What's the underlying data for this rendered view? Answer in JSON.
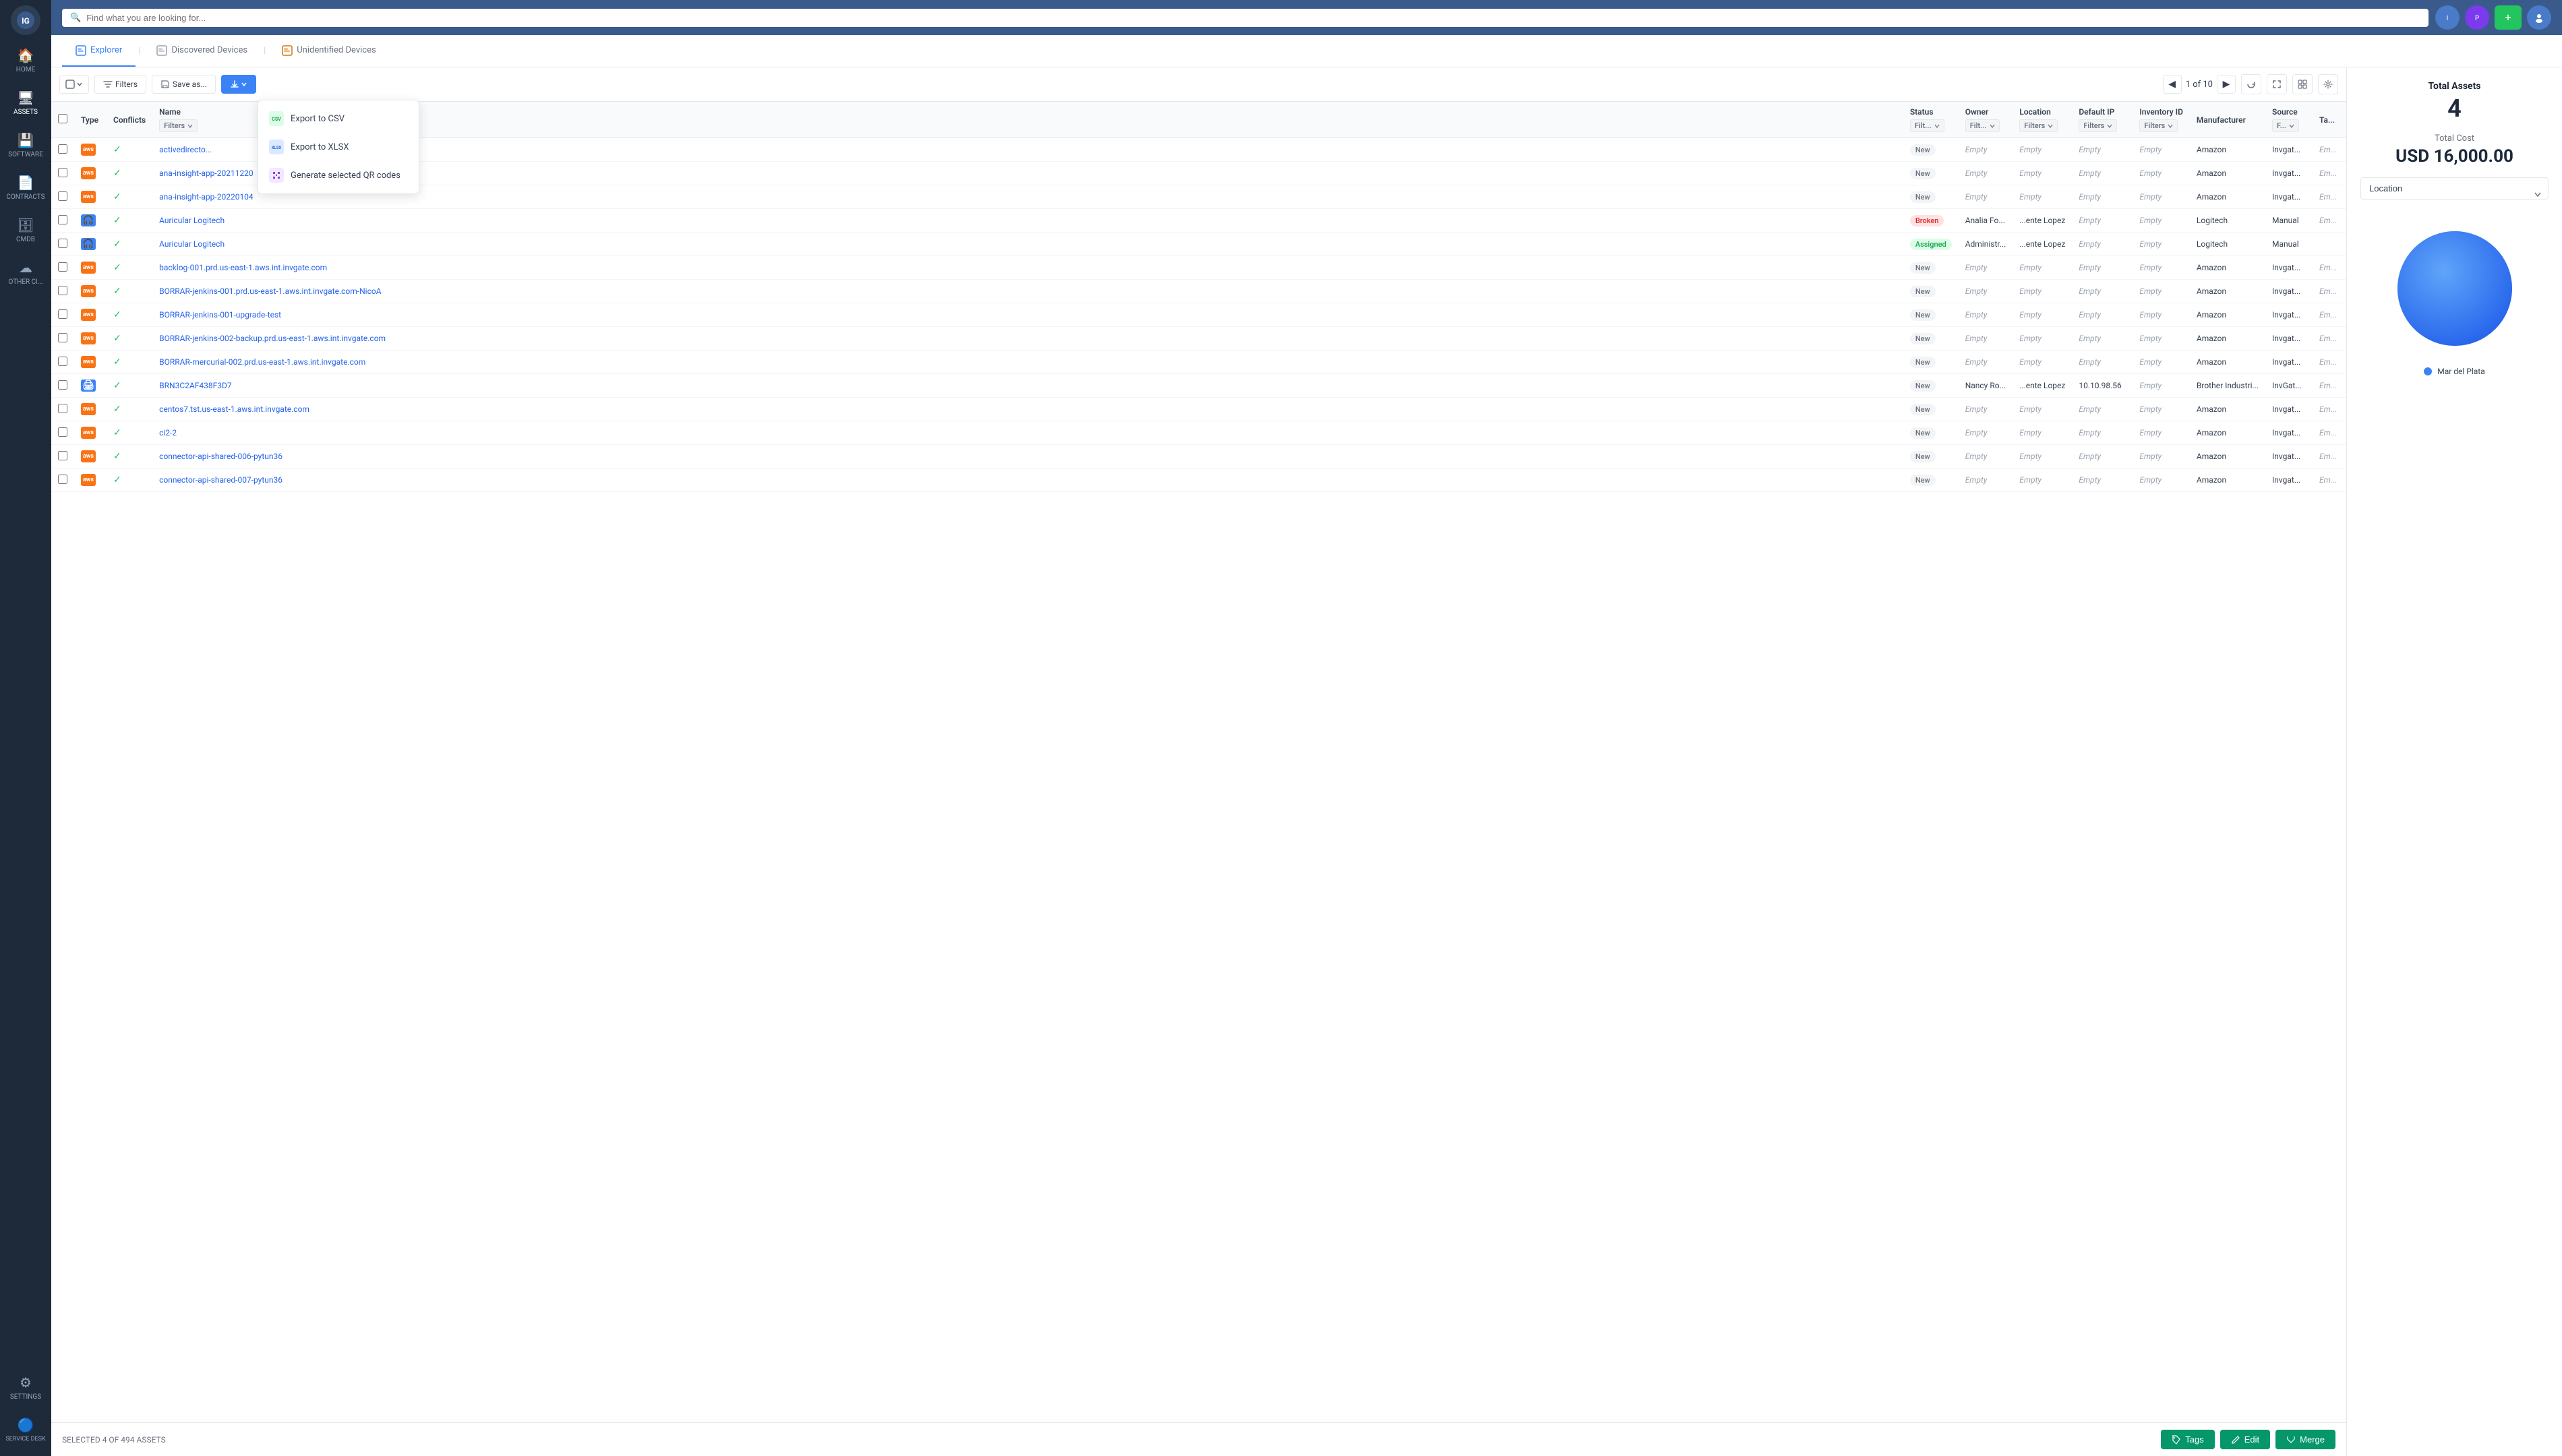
{
  "app": {
    "title": "InvGate Assets",
    "logo_text": "IG"
  },
  "sidebar": {
    "items": [
      {
        "id": "home",
        "label": "HOME",
        "icon": "🏠"
      },
      {
        "id": "assets",
        "label": "ASSETS",
        "icon": "🖥",
        "active": true
      },
      {
        "id": "software",
        "label": "SOFTWARE",
        "icon": "💾"
      },
      {
        "id": "contracts",
        "label": "CONTRACTS",
        "icon": "📄"
      },
      {
        "id": "cmdb",
        "label": "CMDB",
        "icon": "🗄"
      },
      {
        "id": "other",
        "label": "OTHER Cl...",
        "icon": "☁"
      },
      {
        "id": "settings",
        "label": "SETTINGS",
        "icon": "⚙"
      },
      {
        "id": "service_desk",
        "label": "SERVICE DESK",
        "icon": "🔵"
      }
    ]
  },
  "topbar": {
    "search_placeholder": "Find what you are looking for...",
    "icons": [
      "🔔",
      "🟣",
      "➕",
      "👤"
    ]
  },
  "nav_tabs": [
    {
      "id": "explorer",
      "label": "Explorer",
      "icon": "🖥",
      "active": true
    },
    {
      "id": "discovered",
      "label": "Discovered Devices",
      "icon": "📋"
    },
    {
      "id": "unidentified",
      "label": "Unidentified Devices",
      "icon": "📋"
    }
  ],
  "toolbar": {
    "select_btn": "",
    "filters_btn": "Filters",
    "save_btn": "Save as...",
    "download_btn": "",
    "page_prev": "◀",
    "page_current": "1",
    "page_of": "of 10",
    "page_next": "▶"
  },
  "dropdown": {
    "items": [
      {
        "id": "export_csv",
        "label": "Export to CSV",
        "icon_type": "green",
        "icon": "🟢"
      },
      {
        "id": "export_xlsx",
        "label": "Export to XLSX",
        "icon_type": "blue",
        "icon": "🔵"
      },
      {
        "id": "qr_codes",
        "label": "Generate selected QR codes",
        "icon_type": "grid",
        "icon": "⊞"
      }
    ]
  },
  "table": {
    "headers": [
      "",
      "Type",
      "Conflicts",
      "Name",
      "",
      "Status",
      "Owner",
      "Location",
      "Default IP",
      "Inventory ID",
      "Manufacturer",
      "Source",
      "Ta..."
    ],
    "filter_labels": [
      "Filters",
      "Filt...",
      "Filt...",
      "Filters",
      "Filters",
      "Filters",
      "F..."
    ],
    "rows": [
      {
        "checked": false,
        "type": "aws",
        "check": true,
        "name": "activedirecto...",
        "status": "New",
        "owner": "Empty",
        "location": "Empty",
        "ip": "Empty",
        "inv_id": "Empty",
        "manufacturer": "Amazon",
        "source": "Invgat...",
        "tag": "Em..."
      },
      {
        "checked": false,
        "type": "aws",
        "check": true,
        "name": "ana-insight-app-20211220",
        "status": "New",
        "owner": "Empty",
        "location": "Empty",
        "ip": "Empty",
        "inv_id": "Empty",
        "manufacturer": "Amazon",
        "source": "Invgat...",
        "tag": "Em..."
      },
      {
        "checked": false,
        "type": "aws",
        "check": true,
        "name": "ana-insight-app-20220104",
        "status": "New",
        "owner": "Empty",
        "location": "Empty",
        "ip": "Empty",
        "inv_id": "Empty",
        "manufacturer": "Amazon",
        "source": "Invgat...",
        "tag": "Em..."
      },
      {
        "checked": false,
        "type": "headphone",
        "check": true,
        "name": "Auricular Logitech",
        "status": "Broken",
        "owner": "Analia Fo...",
        "location": "...ente Lopez",
        "ip": "Empty",
        "inv_id": "Empty",
        "manufacturer": "Logitech",
        "source": "Manual",
        "tag": "Em..."
      },
      {
        "checked": false,
        "type": "headphone",
        "check": true,
        "name": "Auricular Logitech",
        "status": "Assigned",
        "owner": "Administr...",
        "location": "...ente Lopez",
        "ip": "Empty",
        "inv_id": "Empty",
        "manufacturer": "Logitech",
        "source": "Manual",
        "tag": ""
      },
      {
        "checked": false,
        "type": "aws",
        "check": true,
        "name": "backlog-001.prd.us-east-1.aws.int.invgate.com",
        "status": "New",
        "owner": "Empty",
        "location": "Empty",
        "ip": "Empty",
        "inv_id": "Empty",
        "manufacturer": "Amazon",
        "source": "Invgat...",
        "tag": "Em..."
      },
      {
        "checked": false,
        "type": "aws",
        "check": true,
        "name": "BORRAR-jenkins-001.prd.us-east-1.aws.int.invgate.com-NicoA",
        "status": "New",
        "owner": "Empty",
        "location": "Empty",
        "ip": "Empty",
        "inv_id": "Empty",
        "manufacturer": "Amazon",
        "source": "Invgat...",
        "tag": "Em..."
      },
      {
        "checked": false,
        "type": "aws",
        "check": true,
        "name": "BORRAR-jenkins-001-upgrade-test",
        "status": "New",
        "owner": "Empty",
        "location": "Empty",
        "ip": "Empty",
        "inv_id": "Empty",
        "manufacturer": "Amazon",
        "source": "Invgat...",
        "tag": "Em..."
      },
      {
        "checked": false,
        "type": "aws",
        "check": true,
        "name": "BORRAR-jenkins-002-backup.prd.us-east-1.aws.int.invgate.com",
        "status": "New",
        "owner": "Empty",
        "location": "Empty",
        "ip": "Empty",
        "inv_id": "Empty",
        "manufacturer": "Amazon",
        "source": "Invgat...",
        "tag": "Em..."
      },
      {
        "checked": false,
        "type": "aws",
        "check": true,
        "name": "BORRAR-mercurial-002.prd.us-east-1.aws.int.invgate.com",
        "status": "New",
        "owner": "Empty",
        "location": "Empty",
        "ip": "Empty",
        "inv_id": "Empty",
        "manufacturer": "Amazon",
        "source": "Invgat...",
        "tag": "Em..."
      },
      {
        "checked": false,
        "type": "printer",
        "check": true,
        "name": "BRN3C2AF438F3D7",
        "status": "New",
        "owner": "Nancy Ro...",
        "location": "...ente Lopez",
        "ip": "10.10.98.56",
        "inv_id": "Empty",
        "manufacturer": "Brother Industri...",
        "source": "InvGat...",
        "tag": "Em..."
      },
      {
        "checked": false,
        "type": "aws",
        "check": true,
        "name": "centos7.tst.us-east-1.aws.int.invgate.com",
        "status": "New",
        "owner": "Empty",
        "location": "Empty",
        "ip": "Empty",
        "inv_id": "Empty",
        "manufacturer": "Amazon",
        "source": "Invgat...",
        "tag": "Em..."
      },
      {
        "checked": false,
        "type": "aws",
        "check": true,
        "name": "ci2-2",
        "status": "New",
        "owner": "Empty",
        "location": "Empty",
        "ip": "Empty",
        "inv_id": "Empty",
        "manufacturer": "Amazon",
        "source": "Invgat...",
        "tag": "Em..."
      },
      {
        "checked": false,
        "type": "aws",
        "check": true,
        "name": "connector-api-shared-006-pytun36",
        "status": "New",
        "owner": "Empty",
        "location": "Empty",
        "ip": "Empty",
        "inv_id": "Empty",
        "manufacturer": "Amazon",
        "source": "Invgat...",
        "tag": "Em..."
      },
      {
        "checked": false,
        "type": "aws",
        "check": true,
        "name": "connector-api-shared-007-pytun36",
        "status": "New",
        "owner": "Empty",
        "location": "Empty",
        "ip": "Empty",
        "inv_id": "Empty",
        "manufacturer": "Amazon",
        "source": "Invgat...",
        "tag": "Em..."
      }
    ]
  },
  "status_bar": {
    "text": "SELECTED 4 OF 494 ASSETS",
    "tags_btn": "Tags",
    "edit_btn": "Edit",
    "merge_btn": "Merge"
  },
  "right_panel": {
    "total_assets_label": "Total Assets",
    "total_assets_value": "4",
    "total_cost_label": "Total Cost",
    "total_cost_value": "USD 16,000.00",
    "chart_select": "Location",
    "legend_label": "Mar del Plata"
  }
}
